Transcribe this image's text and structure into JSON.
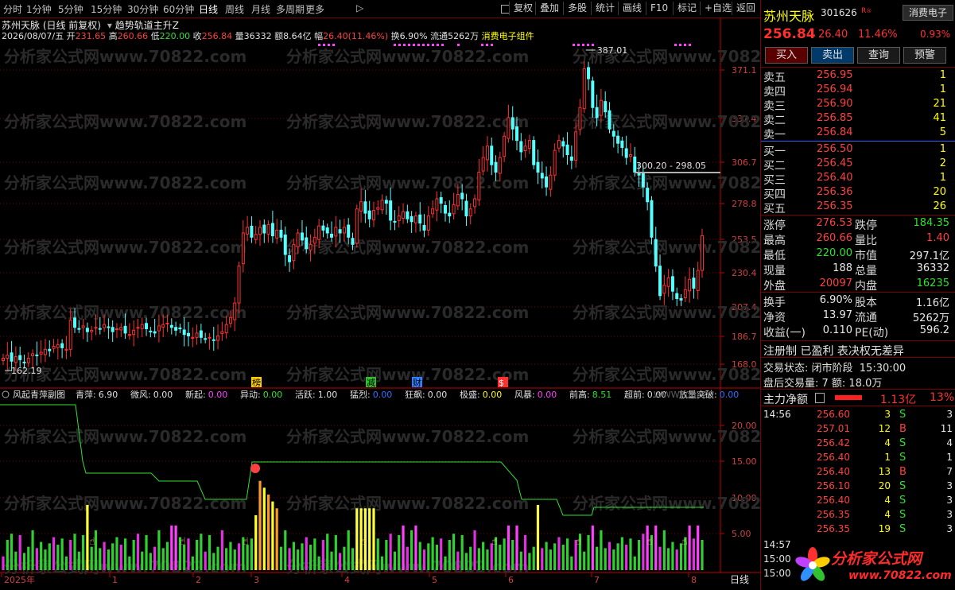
{
  "toolbar": {
    "periods": [
      "分时",
      "1分钟",
      "5分钟",
      "15分钟",
      "30分钟",
      "60分钟",
      "日线",
      "周线",
      "月线",
      "多周期",
      "更多"
    ],
    "active_period": "日线",
    "right_buttons": [
      "复权",
      "叠加",
      "多股",
      "统计",
      "画线",
      "F10",
      "标记",
      "+自选",
      "返回"
    ]
  },
  "chart_header": {
    "stock_title": "苏州天脉 (日线 前复权)",
    "indicator": "趋势轨道主升Z",
    "date": "2026/08/07/五",
    "open_label": "开",
    "open": "231.65",
    "high_label": "高",
    "high": "260.66",
    "low_label": "低",
    "low": "220.00",
    "close_label": "收",
    "close": "256.84",
    "volume_label": "量",
    "volume": "36332",
    "amount_label": "额",
    "amount": "8.64亿",
    "change_label": "幅",
    "change": "26.40(11.46%)",
    "turnover_label": "换",
    "turnover": "6.90%",
    "float_label": "流通",
    "float": "5262万",
    "sector": "消费电子组件"
  },
  "main_axis": {
    "ticks": [
      "371.1",
      "337.4",
      "306.7",
      "278.8",
      "253.5",
      "230.4",
      "207.4",
      "186.7",
      "168.0"
    ],
    "max_label": "387.01",
    "min_label": "162.19",
    "range_label": "300.20 - 298.05"
  },
  "event_markers": [
    "榜",
    "减",
    "财",
    "$"
  ],
  "sub_header": {
    "name": "风起青萍副图",
    "items": [
      {
        "label": "青萍:",
        "value": "6.90",
        "color": "#e0e0e0"
      },
      {
        "label": "微风:",
        "value": "0.00",
        "color": "#e0e0e0"
      },
      {
        "label": "新起:",
        "value": "0.00",
        "color": "#ff40ff"
      },
      {
        "label": "异动:",
        "value": "0.00",
        "color": "#30e030"
      },
      {
        "label": "活跃:",
        "value": "1.00",
        "color": "#e0e0e0"
      },
      {
        "label": "猛烈:",
        "value": "0.00",
        "color": "#3070ff"
      },
      {
        "label": "狂飙:",
        "value": "0.00",
        "color": "#e0e0e0"
      },
      {
        "label": "极盛:",
        "value": "0.00",
        "color": "#ffff00"
      },
      {
        "label": "风暴:",
        "value": "0.00",
        "color": "#ff40ff"
      },
      {
        "label": "前高:",
        "value": "8.51",
        "color": "#30e030"
      },
      {
        "label": "超前:",
        "value": "0.00",
        "color": "#e0e0e0"
      },
      {
        "label": "放量突破:",
        "value": "0.00",
        "color": "#3070ff"
      }
    ],
    "watermark_tail": "WWW70822C"
  },
  "sub_axis": {
    "ticks": [
      "20.00",
      "15.00",
      "10.00",
      "5.00"
    ]
  },
  "xaxis": {
    "labels": [
      "2025年",
      "1",
      "2",
      "3",
      "4",
      "5",
      "6",
      "7",
      "8"
    ],
    "period": "日线"
  },
  "watermark": "分析家公式网www.70822.com",
  "right_panel": {
    "name": "苏州天脉",
    "code": "301626",
    "r_badge": "R",
    "sector": "消费电子",
    "price": "256.84",
    "change": "26.40",
    "pct": "11.46%",
    "sector_pct": "0.93%",
    "buttons": [
      "买入",
      "卖出",
      "查询",
      "预警"
    ],
    "sells": [
      {
        "label": "卖五",
        "price": "256.95",
        "vol": "1"
      },
      {
        "label": "卖四",
        "price": "256.94",
        "vol": "1"
      },
      {
        "label": "卖三",
        "price": "256.90",
        "vol": "21"
      },
      {
        "label": "卖二",
        "price": "256.85",
        "vol": "41"
      },
      {
        "label": "卖一",
        "price": "256.84",
        "vol": "5"
      }
    ],
    "buys": [
      {
        "label": "买一",
        "price": "256.50",
        "vol": "1"
      },
      {
        "label": "买二",
        "price": "256.45",
        "vol": "2"
      },
      {
        "label": "买三",
        "price": "256.40",
        "vol": "1"
      },
      {
        "label": "买四",
        "price": "256.36",
        "vol": "20"
      },
      {
        "label": "买五",
        "price": "256.35",
        "vol": "26"
      }
    ],
    "stats": [
      {
        "l1": "涨停",
        "v1": "276.53",
        "c1": "red",
        "l2": "跌停",
        "v2": "184.35",
        "c2": "green"
      },
      {
        "l1": "最高",
        "v1": "260.66",
        "c1": "red",
        "l2": "量比",
        "v2": "1.40",
        "c2": "red"
      },
      {
        "l1": "最低",
        "v1": "220.00",
        "c1": "green",
        "l2": "市值",
        "v2": "297.1亿",
        "c2": "white"
      },
      {
        "l1": "现量",
        "v1": "188",
        "c1": "white",
        "l2": "总量",
        "v2": "36332",
        "c2": "white"
      },
      {
        "l1": "外盘",
        "v1": "20097",
        "c1": "red",
        "l2": "内盘",
        "v2": "16235",
        "c2": "green"
      }
    ],
    "stats2": [
      {
        "l1": "换手",
        "v1": "6.90%",
        "l2": "股本",
        "v2": "1.16亿"
      },
      {
        "l1": "净资",
        "v1": "13.97",
        "l2": "流通",
        "v2": "5262万"
      },
      {
        "l1": "收益(一)",
        "v1": "0.110",
        "l2": "PE(动)",
        "v2": "596.2"
      }
    ],
    "notes": [
      "注册制 已盈利 表决权无差异"
    ],
    "trade_status_label": "交易状态: 闭市阶段",
    "trade_status_time": "15:30:00",
    "after_hours": "盘后交易量: 7  额: 18.0万",
    "main_flow_label": "主力净额",
    "main_flow_value": "1.13亿",
    "main_flow_pct": "13%",
    "ticks": [
      {
        "time": "14:56",
        "price": "256.60",
        "vol": "3",
        "side": "S",
        "n": "3"
      },
      {
        "time": "",
        "price": "257.01",
        "vol": "12",
        "side": "B",
        "n": "11"
      },
      {
        "time": "",
        "price": "256.42",
        "vol": "4",
        "side": "S",
        "n": "4"
      },
      {
        "time": "",
        "price": "256.40",
        "vol": "1",
        "side": "S",
        "n": "1"
      },
      {
        "time": "",
        "price": "256.40",
        "vol": "13",
        "side": "B",
        "n": "7"
      },
      {
        "time": "",
        "price": "256.10",
        "vol": "20",
        "side": "S",
        "n": "3"
      },
      {
        "time": "",
        "price": "256.40",
        "vol": "4",
        "side": "S",
        "n": "3"
      },
      {
        "time": "",
        "price": "256.35",
        "vol": "4",
        "side": "S",
        "n": "3"
      },
      {
        "time": "",
        "price": "256.35",
        "vol": "19",
        "side": "S",
        "n": "3"
      }
    ],
    "tick_tail_times": [
      "14:57",
      "15:00",
      "15:00"
    ],
    "logo_text": "分析家公式网",
    "logo_url": "www.70822.com"
  },
  "colors": {
    "up": "#ff3030",
    "down": "#54ffff",
    "grid": "#7a0000",
    "axis": "#c00000"
  }
}
